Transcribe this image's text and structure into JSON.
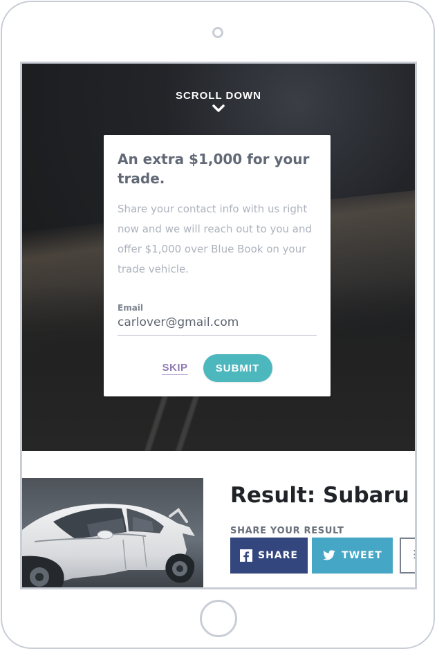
{
  "hero": {
    "scroll_label": "SCROLL DOWN",
    "scroll_icon": "chevron-down-icon"
  },
  "modal": {
    "title": "An extra $1,000 for your trade.",
    "body": "Share your contact info with us right now and we will reach out to you and offer $1,000 over Blue Book on your trade vehicle.",
    "email_label": "Email",
    "email_value": "carlover@gmail.com",
    "skip_label": "SKIP",
    "submit_label": "SUBMIT"
  },
  "result": {
    "title": "Result: Subaru W",
    "share_label": "SHARE YOUR RESULT",
    "facebook_label": "SHARE",
    "twitter_label": "TWEET",
    "facebook_icon": "facebook-icon",
    "twitter_icon": "twitter-icon",
    "more_icon": "more-options-icon"
  },
  "colors": {
    "accent_teal": "#4db7be",
    "skip_purple": "#8f7ab6",
    "facebook_blue": "#33467e",
    "twitter_blue": "#45a6c5",
    "device_gray": "#c8cdd6"
  }
}
